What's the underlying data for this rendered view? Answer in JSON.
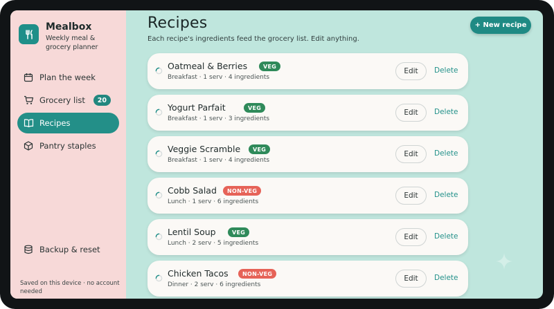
{
  "brand": {
    "name": "Mealbox",
    "subtitle": "Weekly meal & grocery planner"
  },
  "nav": [
    {
      "label": "Plan the week",
      "icon": "calendar-icon",
      "active": false
    },
    {
      "label": "Grocery list",
      "icon": "cart-icon",
      "active": false,
      "badge": "20"
    },
    {
      "label": "Recipes",
      "icon": "book-icon",
      "active": true
    },
    {
      "label": "Pantry staples",
      "icon": "box-icon",
      "active": false
    }
  ],
  "backup": {
    "label": "Backup & reset",
    "icon": "database-icon"
  },
  "saved_note": "Saved on this device · no account needed",
  "header": {
    "title": "Recipes",
    "subtitle": "Each recipe's ingredients feed the grocery list. Edit anything.",
    "new_button": "+ New recipe"
  },
  "actions": {
    "edit": "Edit",
    "delete": "Delete"
  },
  "recipes": [
    {
      "name": "Oatmeal & Berries",
      "tag": "VEG",
      "meta": "Breakfast · 1 serv · 4 ingredients"
    },
    {
      "name": "Yogurt Parfait",
      "tag": "VEG",
      "meta": "Breakfast · 1 serv · 3 ingredients"
    },
    {
      "name": "Veggie Scramble",
      "tag": "VEG",
      "meta": "Breakfast · 1 serv · 4 ingredients"
    },
    {
      "name": "Cobb Salad",
      "tag": "NON-VEG",
      "meta": "Lunch · 1 serv · 6 ingredients"
    },
    {
      "name": "Lentil Soup",
      "tag": "VEG",
      "meta": "Lunch · 2 serv · 5 ingredients"
    },
    {
      "name": "Chicken Tacos",
      "tag": "NON-VEG",
      "meta": "Dinner · 2 serv · 6 ingredients"
    }
  ],
  "colors": {
    "accent": "#1f8f89",
    "sidebar_bg": "#f7d9d8",
    "main_bg": "#bfe6dd",
    "veg": "#2f8a5a",
    "non_veg": "#e66358"
  }
}
